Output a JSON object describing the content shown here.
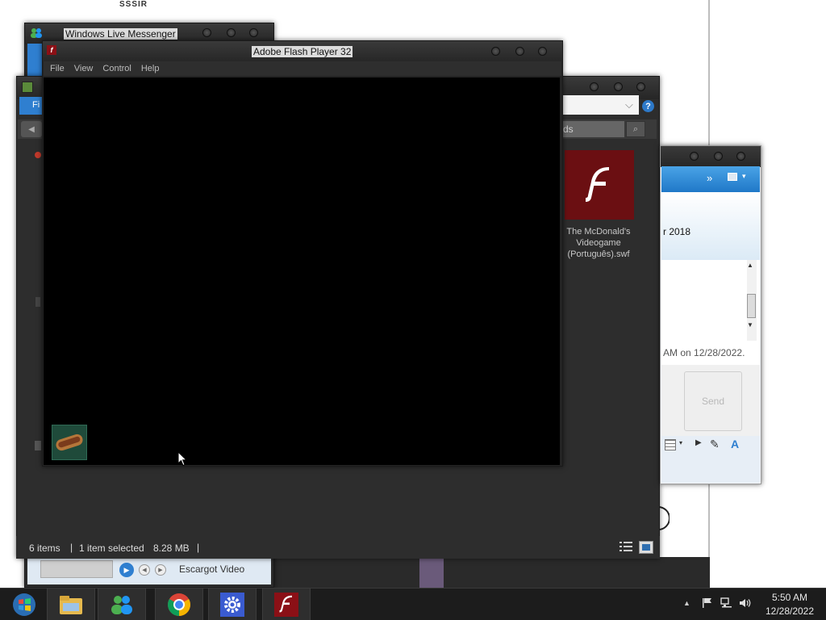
{
  "background": {
    "doc_text": "SSSIR"
  },
  "messenger": {
    "title": "Windows Live Messenger",
    "bottom_label": "Escargot Video"
  },
  "flash": {
    "title": "Adobe Flash Player 32",
    "menu": [
      "File",
      "View",
      "Control",
      "Help"
    ]
  },
  "explorer": {
    "blue_tab_label": "Fi",
    "search_text": "ds",
    "file": {
      "name": "The McDonald's Videogame (Português).swf"
    },
    "status": {
      "items": "6 items",
      "selected": "1 item selected",
      "size": "8.28 MB",
      "separator": "|"
    }
  },
  "chat": {
    "date_partial": "r 2018",
    "message_partial": "AM on 12/28/2022.",
    "send_label": "Send",
    "toolbar_more": "»"
  },
  "taskbar": {
    "apps": [
      "windows-start",
      "file-explorer",
      "messenger",
      "chrome",
      "settings",
      "flash-player"
    ],
    "time": "5:50 AM",
    "date": "12/28/2022"
  },
  "colors": {
    "flash_red": "#8b1016",
    "chat_blue": "#1f78c8",
    "taskbar": "#1c1c1c"
  }
}
